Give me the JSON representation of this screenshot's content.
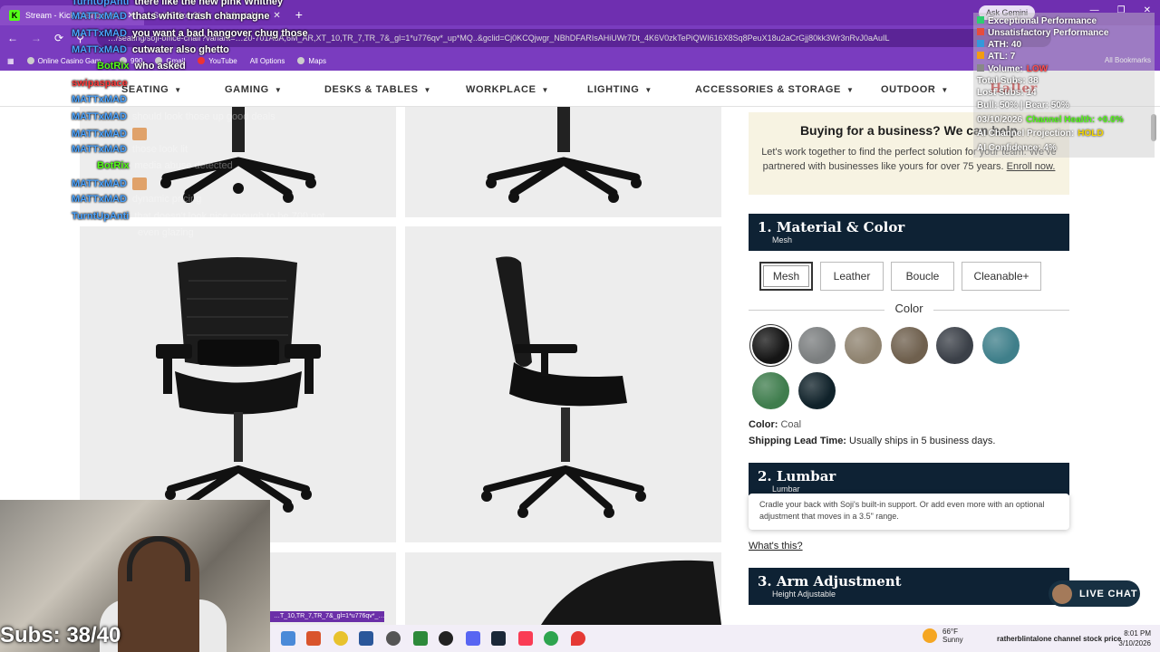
{
  "browser": {
    "tabs": [
      {
        "label": "Stream - Kick Dashboard",
        "active": true
      },
      {
        "label": "Soji Office Chair — Adjustable",
        "active": false
      }
    ],
    "gemini_label": "Ask Gemini",
    "url": "…/seating/soji-office-chair?variant=…20-701A6A,6M_AR,XT_10,TR_7,TR_7&_gl=1*u776qv*_up*MQ..&gclid=Cj0KCQjwgr_NBhDFARIsAHiUWr7Dt_4K6V0zkTePiQWI616X8Sq8PeuX18u2aCrGjj80kk3Wr3nRvJ0aAuIL",
    "bookmarks": [
      "Online Casino Gam...",
      "990",
      "Gmail",
      "YouTube",
      "All Options",
      "Maps"
    ],
    "all_bookmarks": "All Bookmarks"
  },
  "nav": [
    {
      "label": "SEATING"
    },
    {
      "label": "GAMING"
    },
    {
      "label": "DESKS & TABLES"
    },
    {
      "label": "WORKPLACE"
    },
    {
      "label": "LIGHTING"
    },
    {
      "label": "ACCESSORIES & STORAGE"
    },
    {
      "label": "OUTDOOR"
    }
  ],
  "brand": "Haller",
  "business": {
    "title": "Buying for a business? We can help",
    "text": "Let's work together to find the perfect solution for your team. We've partnered with businesses like yours for over 75 years.",
    "link": "Enroll now."
  },
  "section1": {
    "title": "1. Material & Color",
    "sub": "Mesh"
  },
  "materials": [
    "Mesh",
    "Leather",
    "Boucle",
    "Cleanable+"
  ],
  "color_heading": "Color",
  "swatches": [
    {
      "name": "coal",
      "color": "#151515"
    },
    {
      "name": "grey-mesh",
      "color": "#7b7e7f"
    },
    {
      "name": "tan-grey",
      "color": "#8f8370"
    },
    {
      "name": "brown",
      "color": "#6f604e"
    },
    {
      "name": "charcoal",
      "color": "#3b4048"
    },
    {
      "name": "teal",
      "color": "#3f7f8a"
    },
    {
      "name": "green",
      "color": "#3f7d4d"
    },
    {
      "name": "navy-teal",
      "color": "#10222a"
    }
  ],
  "color_label": "Color:",
  "color_value": "Coal",
  "lead_label": "Shipping Lead Time:",
  "lead_value": "Usually ships in 5 business days.",
  "section2": {
    "title": "2. Lumbar",
    "sub": "Lumbar"
  },
  "tooltip": "Cradle your back with Soji's built-in support. Or add even more with an optional adjustment that moves in a 3.5\" range.",
  "whats_this": "What's this?",
  "section3": {
    "title": "3. Arm Adjustment",
    "sub": "Height Adjustable"
  },
  "live_chat": "LIVE CHAT",
  "chat": [
    {
      "user": "TurntUpAnti",
      "msg": "there like the new pink Whitney",
      "color": "#4aa3ff",
      "faint": false
    },
    {
      "user": "MATTxMAD",
      "msg": "thats white trash champagne",
      "color": "#4aa3ff",
      "faint": false
    },
    {
      "user": "MATTxMAD",
      "msg": "you want a bad hangover chug those",
      "color": "#4aa3ff",
      "faint": false
    },
    {
      "user": "MATTxMAD",
      "msg": "cutwater also ghetto",
      "color": "#4aa3ff",
      "faint": false
    },
    {
      "user": "BotRix",
      "msg": "who asked",
      "color": "#53fc18",
      "faint": false
    },
    {
      "user": "swipaspace",
      "msg": "it was 7:43 when u went down",
      "color": "#ff3b3b",
      "faint": true
    },
    {
      "user": "MATTxMAD",
      "msg": "i heard the moby bags is a great chair",
      "color": "#4aa3ff",
      "faint": true
    },
    {
      "user": "MATTxMAD",
      "msg": "should look those up good deals",
      "color": "#4aa3ff",
      "faint": true
    },
    {
      "user": "MATTxMAD",
      "msg": "",
      "color": "#4aa3ff",
      "faint": true,
      "emote": true
    },
    {
      "user": "MATTxMAD",
      "msg": "those look lit",
      "color": "#4aa3ff",
      "faint": true
    },
    {
      "user": "BotRix",
      "msg": "media abuse detected",
      "color": "#53fc18",
      "faint": true
    },
    {
      "user": "MATTxMAD",
      "msg": "",
      "color": "#4aa3ff",
      "faint": true,
      "emote": true
    },
    {
      "user": "MATTxMAD",
      "msg": "dynamic pricing",
      "color": "#4aa3ff",
      "faint": true
    },
    {
      "user": "TurntUpAnti",
      "msg": "that doesn't look nice enough to be 700 not",
      "color": "#4aa3ff",
      "faint": true
    },
    {
      "user": "",
      "msg": "even glazing",
      "color": "#4aa3ff",
      "faint": true
    }
  ],
  "stats": [
    {
      "text": "Exceptional Performance",
      "color": "#2ecc71"
    },
    {
      "text": "Unsatisfactory Performance",
      "color": "#e74c3c"
    },
    {
      "text": "ATH: 40",
      "color": "#3498db"
    },
    {
      "text": "ATL: 7",
      "color": "#f39c12"
    },
    {
      "text": "Volume:",
      "color": "#888888",
      "extra": "LOW",
      "extra_color": "#ff4d4d"
    },
    {
      "text": "Total Subs: 38",
      "color": ""
    },
    {
      "text": "Lost Subs: 14",
      "color": ""
    },
    {
      "text": "Bull: 50% | Bear: 50%",
      "color": ""
    },
    {
      "text": "03/10/2026",
      "color": "",
      "extra": "Channel Health: +0.0%",
      "extra_color": "#53fc18"
    },
    {
      "text": "AI Channel Projection:",
      "color": "",
      "extra": "HOLD",
      "extra_color": "#f5d800"
    },
    {
      "text": "AI Confidence: 4%",
      "color": ""
    }
  ],
  "subs_label": "Subs: 38/40",
  "url_pill": "…T_10,TR_7,TR_7&_gl=1*u776qv*_…",
  "taskbar": {
    "weather_temp": "66°F",
    "weather_desc": "Sunny",
    "ticker": "ratherblintalone channel stock price",
    "time": "8:01 PM",
    "date": "3/10/2026"
  }
}
